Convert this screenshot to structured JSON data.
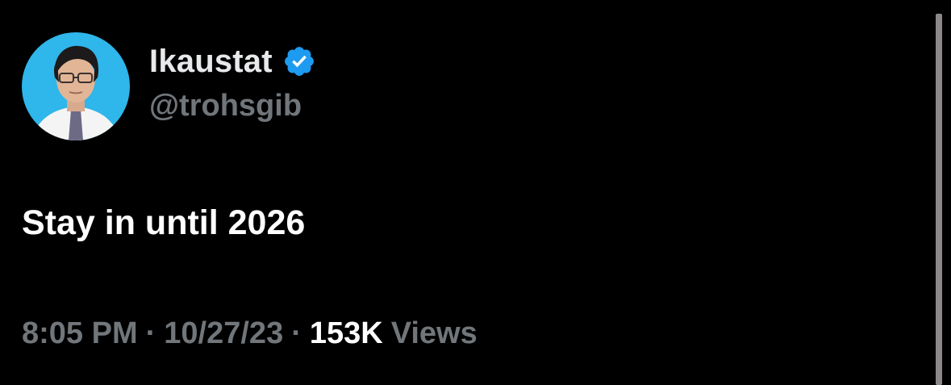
{
  "user": {
    "display_name": "Ikaustat",
    "handle": "@trohsgib",
    "verified_icon": "verified-badge-icon",
    "verified_color": "#1d9bf0",
    "avatar_background": "#2fb6ea"
  },
  "tweet": {
    "text": "Stay in until 2026"
  },
  "meta": {
    "time": "8:05 PM",
    "separator": "·",
    "date": "10/27/23",
    "views_count": "153K",
    "views_label": "Views"
  },
  "colors": {
    "background": "#000000",
    "primary_text": "#ffffff",
    "secondary_text": "#71767b",
    "scrollbar": "#8d8788"
  }
}
